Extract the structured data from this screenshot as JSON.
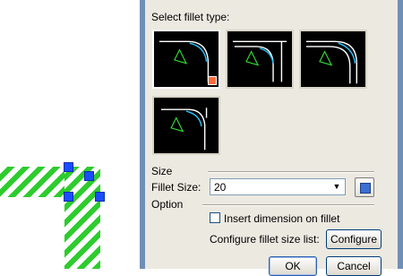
{
  "dialog": {
    "fillet_type_label": "Select fillet type:",
    "fillet_types": [
      "Fillet type 1",
      "Fillet type 2",
      "Fillet type 3",
      "Fillet type 4"
    ],
    "selected_fillet_type": 1,
    "size_section": "Size",
    "fillet_size_label": "Fillet Size:",
    "fillet_size_value": "20",
    "option_section": "Option",
    "insert_dimension_label": "Insert dimension on fillet",
    "insert_dimension_checked": false,
    "configure_list_label": "Configure fillet size list:",
    "configure_button": "Configure",
    "ok_button": "OK",
    "cancel_button": "Cancel"
  },
  "colors": {
    "hatch": "#2ecc2e",
    "grip": "#1a4dff",
    "preview_line": "#ffffff",
    "preview_arc": "#29c4ff",
    "preview_mark": "#33dd33",
    "selection_badge": "#ff6a3a"
  },
  "icons": {
    "dropdown": "chevron-down-icon",
    "pick_size": "pick-size-icon"
  }
}
